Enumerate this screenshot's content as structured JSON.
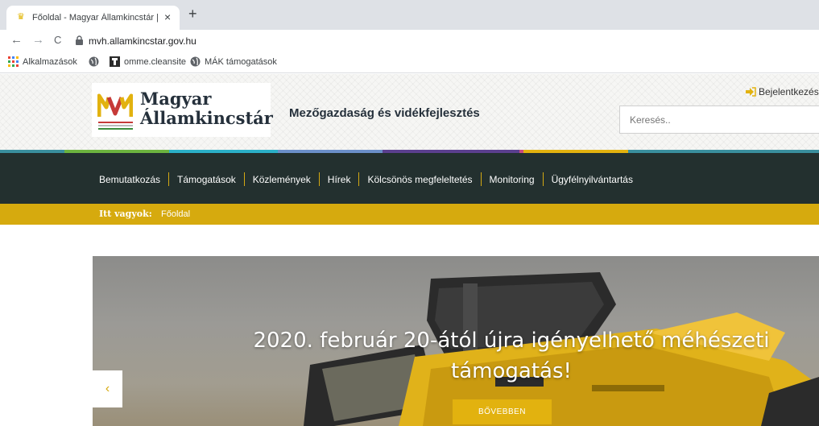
{
  "browser": {
    "tab_title": "Főoldal - Magyar Államkincstár | K",
    "tab_close": "×",
    "new_tab": "+",
    "back": "←",
    "forward": "→",
    "reload": "C",
    "url": "mvh.allamkincstar.gov.hu",
    "bookmarks": [
      "Alkalmazások",
      "omme.cleansite",
      "MÁK támogatások"
    ]
  },
  "header": {
    "logo_line1": "Magyar",
    "logo_line2": "Államkincstár",
    "tagline": "Mezőgazdaság és vidékfejlesztés",
    "login": "Bejelentkezés",
    "search_placeholder": "Keresés.."
  },
  "colors": {
    "nav_bg": "#23302f",
    "accent_gold": "#d6aa0e",
    "button_gold": "#e2b20f",
    "stripe_bar": [
      "#3a8f9e",
      "#6cb33f",
      "#2bb0c8",
      "#6b8fc9",
      "#5b3f8f",
      "#c94a82",
      "#e2b20f",
      "#3a8f9e"
    ]
  },
  "nav": {
    "items": [
      "Bemutatkozás",
      "Támogatások",
      "Közlemények",
      "Hírek",
      "Kölcsönös megfeleltetés",
      "Monitoring",
      "Ügyfélnyilvántartás"
    ]
  },
  "breadcrumb": {
    "label": "Itt vagyok:",
    "current": "Főoldal"
  },
  "hero": {
    "title": "2020. február 20-ától újra igényelhető méhészeti támogatás!",
    "button": "BŐVEBBEN",
    "prev_arrow": "‹"
  }
}
